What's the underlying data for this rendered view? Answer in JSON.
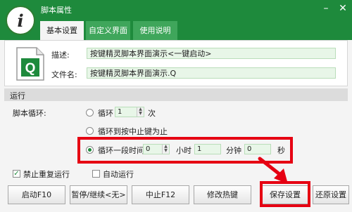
{
  "window": {
    "title": "脚本属性",
    "logo_letter": "i"
  },
  "tabs": [
    {
      "label": "基本设置",
      "active": true
    },
    {
      "label": "自定义界面",
      "active": false
    },
    {
      "label": "使用说明",
      "active": false
    }
  ],
  "info": {
    "desc_label": "描述:",
    "desc_value": "按键精灵脚本界面演示<一键启动>",
    "file_label": "文件名:",
    "file_value": "按键精灵脚本界面演示.Q",
    "file_icon_letter": "Q"
  },
  "run": {
    "section_label": "运行",
    "loop_label": "脚本循环:",
    "option_loop": {
      "label": "循环",
      "value": "1",
      "unit": "次"
    },
    "option_until_stop": {
      "label": "循环到按中止键为止"
    },
    "option_duration": {
      "label": "循环一段时间",
      "hours": "0",
      "hours_unit": "小时",
      "minutes": "1",
      "minutes_unit": "分钟",
      "seconds": "0",
      "seconds_unit": "秒"
    },
    "selected_option": "option_duration"
  },
  "checkboxes": {
    "no_repeat": {
      "label": "禁止重复运行",
      "checked": true
    },
    "auto_run": {
      "label": "自动运行",
      "checked": false
    }
  },
  "buttons": {
    "start": "启动F10",
    "pause": "暂停/继续<无>",
    "stop": "中止F12",
    "hotkey": "修改热键",
    "save": "保存设置",
    "restore": "还原设置"
  },
  "colors": {
    "accent": "#1e8a3c",
    "highlight": "#e60012"
  }
}
